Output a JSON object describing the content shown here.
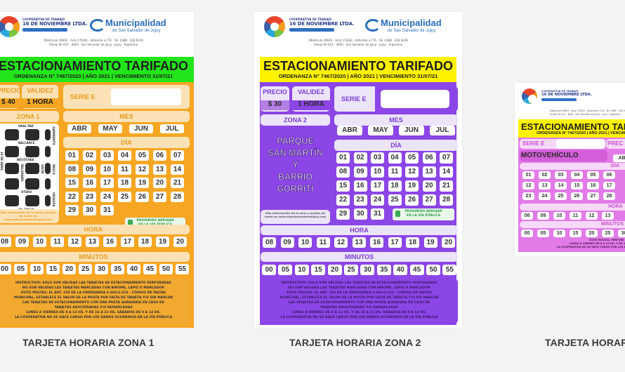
{
  "page": {
    "background": "#f3f3f3"
  },
  "common": {
    "coop_small": "COOPERATIVA DE TRABAJO",
    "coop_name": "16 DE NOVIEMBRE LTDA.",
    "muni_name": "Municipalidad",
    "muni_sub": "de San Salvador de Jujuy",
    "addr_line1": "[Matrícula 30693 · Acta 17638] · Adherida a CTA · Tel. 0388 · 428 9239",
    "addr_line2": "Alvear Nº 615 · 4600 · San Salvador de Jujuy · Jujuy · Argentina",
    "title": "ESTACIONAMIENTO TARIFADO",
    "subtitle": "ORDENANZA N° 7467/2020 | AÑO 2021 | VENCIMIENTO 31/07/21",
    "precio_label": "PRECIO",
    "validez_label": "VALIDEZ",
    "validez_value": "1 HORA",
    "serie_label": "SERIE E",
    "mes_label": "MES",
    "months": [
      "ABR",
      "MAY",
      "JUN",
      "JUL"
    ],
    "dia_label": "DÍA",
    "days": [
      "01",
      "02",
      "03",
      "04",
      "05",
      "06",
      "07",
      "08",
      "09",
      "10",
      "11",
      "12",
      "13",
      "14",
      "15",
      "16",
      "17",
      "18",
      "19",
      "20",
      "21",
      "22",
      "23",
      "24",
      "25",
      "26",
      "27",
      "28",
      "29",
      "30",
      "31"
    ],
    "eco_line1": "PROHIBIDO ARROJAR",
    "eco_line2": "EN LA VÍA PÚBLICA",
    "hora_label": "HORA",
    "hours": [
      "08",
      "09",
      "10",
      "11",
      "12",
      "13",
      "16",
      "17",
      "18",
      "19",
      "20"
    ],
    "minutos_label": "MINUTOS",
    "minutes": [
      "00",
      "05",
      "10",
      "15",
      "20",
      "25",
      "30",
      "35",
      "40",
      "45",
      "50",
      "55"
    ],
    "map_info": "Más información de la zona y puntos de venta en www.estacionamientojujuy.com",
    "instructions": [
      "INSTRUCTIVO: SOLO SON VÁLIDAS LAS TARJETAS DE ESTACIONAMIENTO PERFORADAS",
      "NO SON VÁLIDAS LAS TARJETAS MARCADAS CON BIROME, LÁPIZ O MARCADOR",
      "EVITE MULTAS: EL ART. 159 DE LA ORDENANZA 6.666/2.016 · CÓDIGO DE FALTAS",
      "MUNICIPAL, ESTABLECE EL VALOR DE LA MULTA POR FALTA DE TARJETA Y/O SIN MARCAR",
      "LAS TARJETAS DE ESTACIONAMIENTO CON UNA MULTA AGRAVADA EN CASO DE",
      "TARJETAS ADULTERADAS Y/O REMARCADAS",
      "LUNES A VIERNES DE 8 A 13 HS. Y DE 16 A 21 HS.   SÁBADOS DE 9 A 14 HS.",
      "LA COOPERATIVA NO SE HACE CARGO POR LOS DAÑOS OCURRIDOS EN LA VÍA PÚBLICA"
    ]
  },
  "cards": [
    {
      "caption": "TARJETA HORARIA ZONA 1",
      "price": "$ 40",
      "zone_label": "ZONA 1",
      "streets": [
        "GRAL PAZ",
        "BALCARCE",
        "NECOCHEA",
        "OTERO",
        "AV. ITALIA",
        "BELGRANO",
        "SALTA",
        "SARMIENTO",
        "PASCO",
        "URQUIZA",
        "SENADOR PEREZ",
        "19 DE ABRIL"
      ],
      "colors": {
        "title_band": "#22e619",
        "main": "#f6a623",
        "soft": "#fbe2b6",
        "label": "#e89a1c"
      }
    },
    {
      "caption": "TARJETA HORARIA ZONA 2",
      "price": "$ 30",
      "zone_label": "ZONA 2",
      "zone_area": [
        "PARQUE",
        "SAN MARTÍN",
        "Y",
        "BARRIO",
        "GORRITI"
      ],
      "colors": {
        "title_band": "#fff200",
        "main": "#8c45e6",
        "soft": "#ece4f8",
        "label": "#7a3bd8"
      }
    },
    {
      "caption": "TARJETA HORARIA MOTOVEHÍCULO",
      "caption_visible": "TARJETA HORAR",
      "vehicle_label": "MOTOVEHÍCULO",
      "price_label_partial": "PREC",
      "month_partial": "ABR",
      "day_rows": [
        [
          "01",
          "02",
          "03",
          "04",
          "05",
          "06"
        ],
        [
          "12",
          "13",
          "14",
          "15",
          "16",
          "17"
        ],
        [
          "23",
          "24",
          "25",
          "26",
          "27",
          "28"
        ]
      ],
      "hours_partial": [
        "08",
        "09",
        "10",
        "11",
        "12",
        "13"
      ],
      "minutes_partial": [
        "00",
        "05",
        "10",
        "15",
        "20",
        "25",
        "30"
      ],
      "footer_lines": [
        "EVITE MULTAS, PERFORE Y DEJE",
        "LUNES A VIERNES DE 8 A 13 HS. Y DE 16 A 21",
        "LA COOPERATIVA NO SE HACE CARGO POR LOS DAÑOS"
      ],
      "colors": {
        "title_band": "#fff200",
        "main": "#e27ae8",
        "soft": "#f6d9f7",
        "label": "#c84fd0"
      }
    }
  ]
}
